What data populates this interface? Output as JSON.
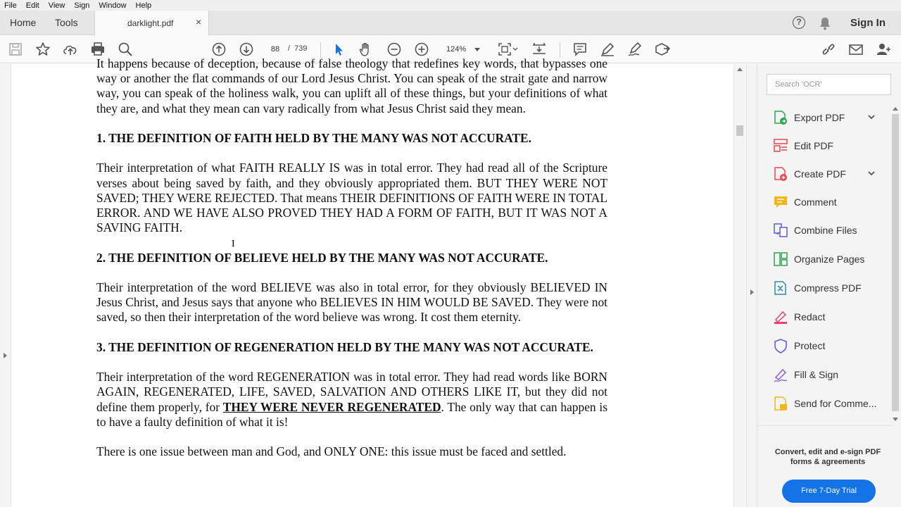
{
  "menu": [
    "File",
    "Edit",
    "View",
    "Sign",
    "Window",
    "Help"
  ],
  "tabs": {
    "home": "Home",
    "tools": "Tools",
    "document": "darklight.pdf",
    "close": "×"
  },
  "header": {
    "help": "?",
    "signin": "Sign In"
  },
  "toolbar": {
    "page_current": "88",
    "page_separator": "/",
    "page_total": "739",
    "zoom": "124%",
    "icons": [
      "save-icon",
      "bookmark-star-icon",
      "upload-cloud-icon",
      "print-icon",
      "search-zoom-icon",
      "page-up-icon",
      "page-down-icon",
      "select-arrow-icon",
      "hand-tool-icon",
      "zoom-out-icon",
      "zoom-in-icon",
      "page-fit-icon",
      "scroll-mode-icon",
      "comment-icon",
      "highlight-pen-icon",
      "sign-pen-icon",
      "more-tools-icon",
      "share-link-icon",
      "email-icon",
      "add-user-icon"
    ]
  },
  "document": {
    "para1": "It happens because of deception, because of false theology that redefines key words, that bypasses one way or another the flat commands of our Lord Jesus Christ. You can speak of the strait gate and narrow way, you can speak of the holiness walk, you can uplift all of these things, but your definitions of what they are, and what they mean can vary radically from what Jesus Christ said they mean.",
    "heading1": "1. THE DEFINITION OF FAITH HELD BY THE MANY WAS NOT ACCURATE.",
    "para2": "Their interpretation of what FAITH REALLY IS was in total error. They had read all of the Scripture verses about being saved by faith, and they obviously appropriated them. BUT THEY WERE NOT SAVED; THEY WERE REJECTED. That means THEIR DEFINITIONS OF FAITH WERE IN TOTAL ERROR. AND WE HAVE ALSO PROVED THEY HAD A FORM OF FAITH, BUT IT WAS NOT A SAVING FAITH.",
    "heading2": "2. THE DEFINITION OF BELIEVE HELD BY THE MANY WAS NOT ACCURATE.",
    "para3": "Their interpretation of the word BELIEVE was also in total error, for they obviously BELIEVED IN Jesus Christ, and Jesus says that anyone who BELIEVES IN HIM WOULD BE SAVED. They were not saved, so then their interpretation of the word believe was wrong. It cost them eternity.",
    "heading3": "3. THE DEFINITION OF REGENERATION HELD BY THE MANY WAS NOT ACCURATE.",
    "para4_a": "Their interpretation of the word REGENERATION was in total error. They had read words like BORN AGAIN, REGENERATED, LIFE, SAVED, SALVATION AND OTHERS LIKE IT, but they did not define them properly, for ",
    "para4_b": "THEY WERE NEVER REGENERATED",
    "para4_c": ". The only way that can happen is to have a faulty definition of what it is!",
    "para5": "There is one issue between man and God, and ONLY ONE: this issue must be faced and settled."
  },
  "right_pane": {
    "search_placeholder": "Search 'OCR'",
    "tools": [
      {
        "label": "Export PDF",
        "icon": "export-pdf-icon",
        "color": "#2da44e",
        "expandable": true
      },
      {
        "label": "Edit PDF",
        "icon": "edit-pdf-icon",
        "color": "#e34850",
        "expandable": false
      },
      {
        "label": "Create PDF",
        "icon": "create-pdf-icon",
        "color": "#e34850",
        "expandable": true
      },
      {
        "label": "Comment",
        "icon": "comment-tool-icon",
        "color": "#f2b51b",
        "expandable": false
      },
      {
        "label": "Combine Files",
        "icon": "combine-files-icon",
        "color": "#5c5ce0",
        "expandable": false
      },
      {
        "label": "Organize Pages",
        "icon": "organize-pages-icon",
        "color": "#2da44e",
        "expandable": false
      },
      {
        "label": "Compress PDF",
        "icon": "compress-pdf-icon",
        "color": "#2b8f9d",
        "expandable": false
      },
      {
        "label": "Redact",
        "icon": "redact-icon",
        "color": "#e0437a",
        "expandable": false
      },
      {
        "label": "Protect",
        "icon": "protect-shield-icon",
        "color": "#5c5ce0",
        "expandable": false
      },
      {
        "label": "Fill & Sign",
        "icon": "fill-sign-icon",
        "color": "#8b5cd6",
        "expandable": false
      },
      {
        "label": "Send for Comme...",
        "icon": "send-comments-icon",
        "color": "#f2b51b",
        "expandable": false
      }
    ],
    "promo_text": "Convert, edit and e-sign PDF forms & agreements",
    "trial_button": "Free 7-Day Trial"
  }
}
